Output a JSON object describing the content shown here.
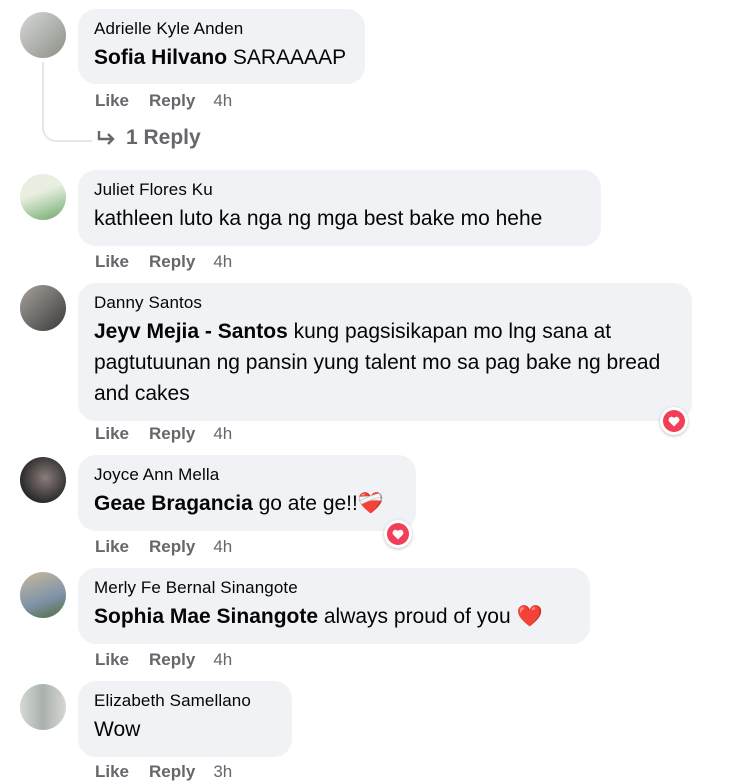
{
  "comments": [
    {
      "author": "Adrielle Kyle Anden",
      "tag": "Sofia Hilvano",
      "text": " SARAAAAP",
      "like": "Like",
      "reply": "Reply",
      "time": "4h",
      "replies_label": "1 Reply",
      "avatar_colors": [
        "#c9c9c9",
        "#8a8f86"
      ]
    },
    {
      "author": "Juliet Flores Ku",
      "tag": "",
      "text": "kathleen luto ka nga ng mga best bake mo hehe",
      "like": "Like",
      "reply": "Reply",
      "time": "4h",
      "avatar_colors": [
        "#6ea86a",
        "#e8efe1"
      ]
    },
    {
      "author": "Danny Santos",
      "tag": "Jeyv Mejia - Santos",
      "text": " kung pagsisikapan mo lng sana at pagtutuunan ng pansin yung talent mo sa pag bake ng bread and cakes",
      "like": "Like",
      "reply": "Reply",
      "time": "4h",
      "reaction": "heart",
      "avatar_colors": [
        "#4a4a4a",
        "#a7a29c"
      ]
    },
    {
      "author": "Joyce Ann Mella",
      "tag": "Geae Bragancia",
      "text": " go ate ge!!",
      "emoji": "❤️‍🩹",
      "like": "Like",
      "reply": "Reply",
      "time": "4h",
      "reaction": "heart",
      "avatar_colors": [
        "#2a2a2a",
        "#8b7d7a"
      ]
    },
    {
      "author": "Merly Fe Bernal Sinangote",
      "tag": "Sophia Mae Sinangote",
      "text": " always proud of you ",
      "emoji": "❤️",
      "like": "Like",
      "reply": "Reply",
      "time": "4h",
      "avatar_colors": [
        "#7e93a8",
        "#c8b99c"
      ]
    },
    {
      "author": "Elizabeth Samellano",
      "tag": "",
      "text": "Wow",
      "like": "Like",
      "reply": "Reply",
      "time": "3h",
      "avatar_colors": [
        "#a9b1ae",
        "#d6d8d2"
      ]
    }
  ],
  "colors": {
    "bubble": "#f0f2f5",
    "meta": "#65676b",
    "heart": "#f33e58"
  }
}
